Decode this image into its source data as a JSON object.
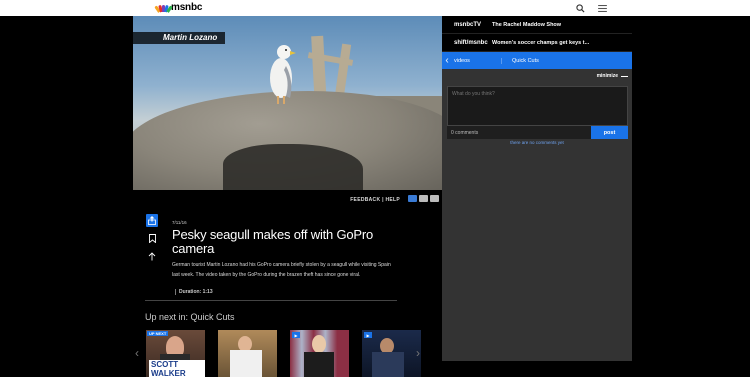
{
  "header": {
    "logo_text": "msnbc",
    "search_icon": "search-icon",
    "menu_icon": "hamburger-icon"
  },
  "video": {
    "caption_name": "Martin Lozano",
    "feedback": "FEEDBACK | HELP",
    "view_icons": [
      "list-view-icon",
      "compact-view-icon",
      "grid-view-icon"
    ]
  },
  "article": {
    "date": "7/11/16",
    "headline": "Pesky seagull makes off with GoPro camera",
    "description": "German tourist Martin Lozano had his GoPro camera briefly stolen by a seagull while visiting Spain last week. The video taken by the GoPro during the brazen theft has since gone viral.",
    "duration": "Duration: 1:13"
  },
  "upnext": {
    "title": "Up next in: Quick Cuts",
    "thumbs": [
      {
        "badge": "UP NEXT",
        "overlay": "SCOTT WALKER"
      },
      {
        "badge": "",
        "overlay": ""
      },
      {
        "badge": "",
        "overlay": ""
      },
      {
        "badge": "",
        "overlay": ""
      }
    ]
  },
  "sidebar": {
    "schedule": [
      {
        "network": "msnbcTV",
        "show": "The Rachel Maddow Show"
      },
      {
        "network": "shift/msnbc",
        "show": "Women's soccer champs get keys t..."
      }
    ],
    "videos_label": "videos",
    "section_label": "Quick Cuts",
    "minimize_label": "minimize",
    "comment_placeholder": "What do you think?",
    "comment_count": "0 comments",
    "post_label": "post",
    "no_comments": "there are no comments yet"
  },
  "colors": {
    "accent": "#1a73e8",
    "panel": "#333333",
    "background": "#000000"
  }
}
